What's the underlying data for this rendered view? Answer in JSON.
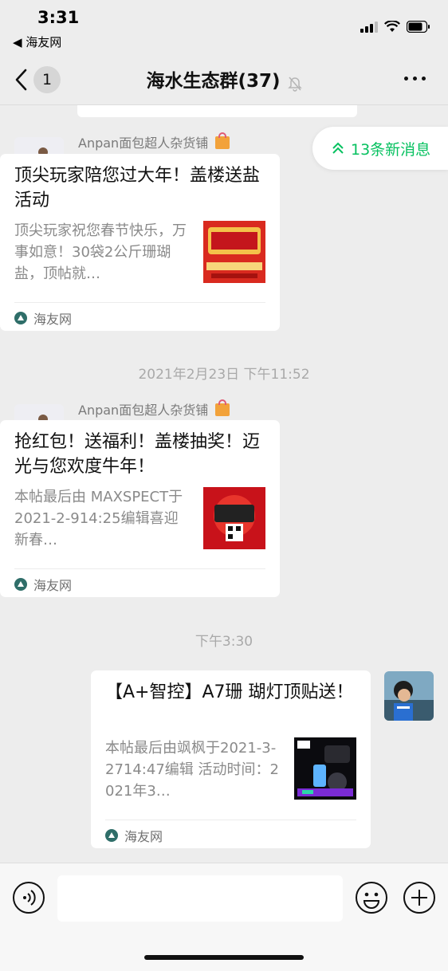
{
  "status_bar": {
    "time": "3:31",
    "back_app": "◀ 海友网"
  },
  "nav": {
    "back_count": "1",
    "title": "海水生态群(37)"
  },
  "new_messages": {
    "label": "13条新消息"
  },
  "messages": [
    {
      "sender": "Anpan面包超人杂货铺",
      "title": "顶尖玩家陪您过大年！盖楼送盐活动",
      "desc": "顶尖玩家祝您春节快乐，万事如意！30袋2公斤珊瑚盐，顶帖就…",
      "source": "海友网"
    },
    {
      "sender": "Anpan面包超人杂货铺",
      "title": "抢红包！送福利！盖楼抽奖！迈光与您欢度牛年！",
      "desc": "本帖最后由 MAXSPECT于2021-2-914:25编辑喜迎新春…",
      "source": "海友网"
    },
    {
      "title": "【A+智控】A7珊 瑚灯顶贴送！",
      "desc": "本帖最后由飒枫于2021-3-2714:47编辑 活动时间：2021年3…",
      "source": "海友网"
    }
  ],
  "timestamps": [
    "2021年2月23日 下午11:52",
    "下午3:30"
  ],
  "colors": {
    "accent_green": "#07c160",
    "background": "#ededed",
    "card": "#ffffff"
  }
}
